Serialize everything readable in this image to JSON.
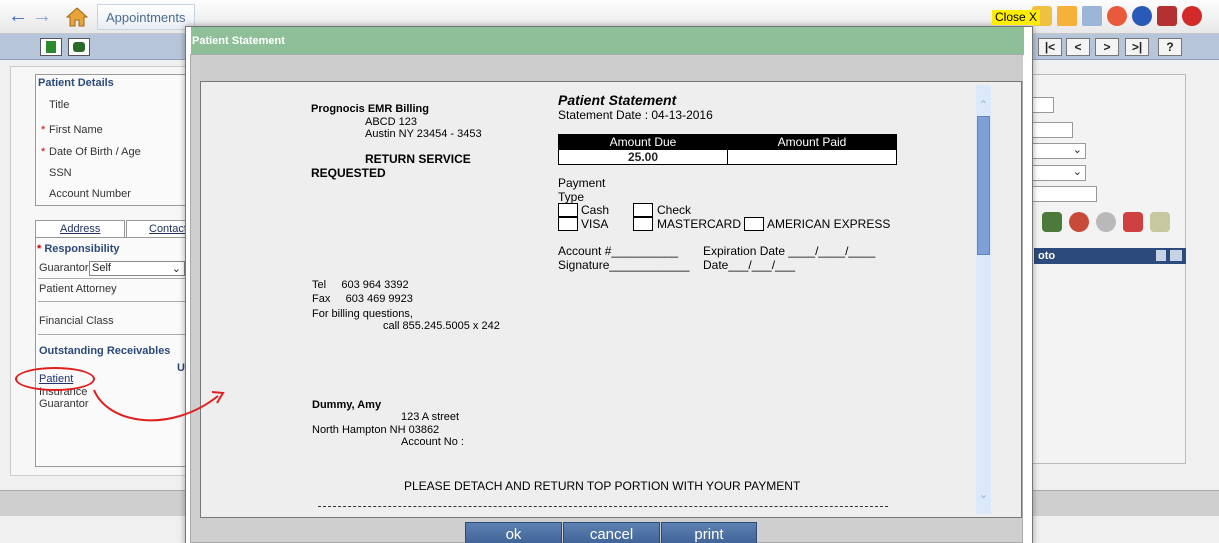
{
  "app": {
    "tab_appointments": "Appointments"
  },
  "left_panel": {
    "patient_details_title": "Patient Details",
    "fields": {
      "title": "Title",
      "first_name": "First Name",
      "dob_age": "Date Of Birth / Age",
      "ssn": "SSN",
      "account_number": "Account Number"
    },
    "tabs": {
      "address": "Address",
      "contact": "Contact"
    },
    "responsibility": "Responsibility",
    "guarantor_label": "Guarantor",
    "guarantor_value": "Self",
    "patient_attorney": "Patient Attorney",
    "financial_class": "Financial Class",
    "outstanding_receivables": "Outstanding Receivables",
    "col_u": "U",
    "receivables": {
      "patient": "Patient",
      "insurance": "Insurance",
      "guarantor": "Guarantor"
    }
  },
  "right_panel": {
    "header_fragment": "oto"
  },
  "nav_buttons": [
    "|<",
    "<",
    ">",
    ">|",
    "?"
  ],
  "modal": {
    "title": "Patient Statement",
    "close": "Close X",
    "statement": {
      "billing_name": "Prognocis EMR Billing",
      "address1": "ABCD 123",
      "address2": "Austin NY 23454 - 3453",
      "return_service_1": "RETURN SERVICE",
      "return_service_2": "REQUESTED",
      "heading": "Patient Statement",
      "statement_date": "Statement Date : 04-13-2016",
      "amount_due_label": "Amount Due",
      "amount_paid_label": "Amount Paid",
      "amount_due_value": "25.00",
      "amount_paid_value": "",
      "payment_label": "Payment",
      "type_label": "Type",
      "options": {
        "cash": "Cash",
        "check": "Check",
        "visa": "VISA",
        "mastercard": "MASTERCARD",
        "amex": "AMERICAN EXPRESS"
      },
      "account_line": "Account #__________",
      "expiration_line": "Expiration Date ____/____/____",
      "signature_line": "Signature____________",
      "date_line": "Date___/___/___",
      "tel": "Tel     603 964 3392",
      "fax": "Fax     603 469 9923",
      "billing_questions": "For billing questions,",
      "call_line": "call 855.245.5005 x 242",
      "patient_name": "Dummy, Amy",
      "patient_street": "123 A street",
      "patient_city": "North Hampton NH 03862",
      "account_no": "Account No :",
      "detach_note": "PLEASE DETACH AND RETURN TOP PORTION WITH YOUR PAYMENT"
    },
    "buttons": {
      "ok": "ok",
      "cancel": "cancel",
      "print": "print"
    }
  },
  "colors": {
    "title_bar": "#8fbf98",
    "close_bg": "#ffee00",
    "button_blue": "#4a6ea2",
    "annotation_red": "#e02020"
  }
}
